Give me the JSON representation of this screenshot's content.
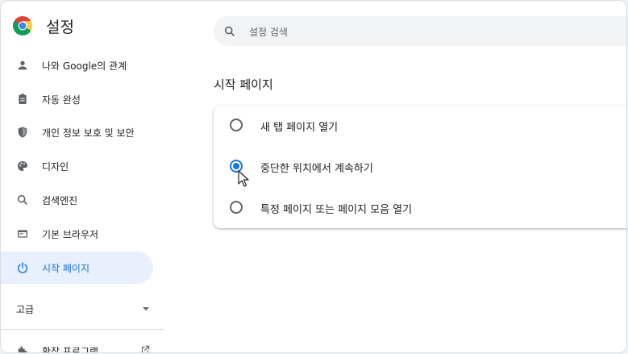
{
  "app": {
    "title": "설정",
    "logo_icon": "chrome-logo"
  },
  "search": {
    "placeholder": "설정 검색",
    "value": ""
  },
  "sidebar": {
    "items": [
      {
        "label": "나와 Google의 관계",
        "icon": "person-icon"
      },
      {
        "label": "자동 완성",
        "icon": "clipboard-icon"
      },
      {
        "label": "개인 정보 보호 및 보안",
        "icon": "shield-icon"
      },
      {
        "label": "디자인",
        "icon": "palette-icon"
      },
      {
        "label": "검색엔진",
        "icon": "search-icon"
      },
      {
        "label": "기본 브라우저",
        "icon": "browser-icon"
      },
      {
        "label": "시작 페이지",
        "icon": "power-icon",
        "active": true
      }
    ],
    "advanced_label": "고급",
    "extensions_label": "확장 프로그램"
  },
  "main": {
    "section_title": "시작 페이지",
    "options": [
      {
        "label": "새 탭 페이지 열기",
        "checked": false
      },
      {
        "label": "중단한 위치에서 계속하기",
        "checked": true
      },
      {
        "label": "특정 페이지 또는 페이지 모음 열기",
        "checked": false
      }
    ]
  },
  "colors": {
    "accent": "#1a73e8",
    "active_bg": "#e8f0fe",
    "text": "#202124",
    "icon": "#5f6368"
  }
}
